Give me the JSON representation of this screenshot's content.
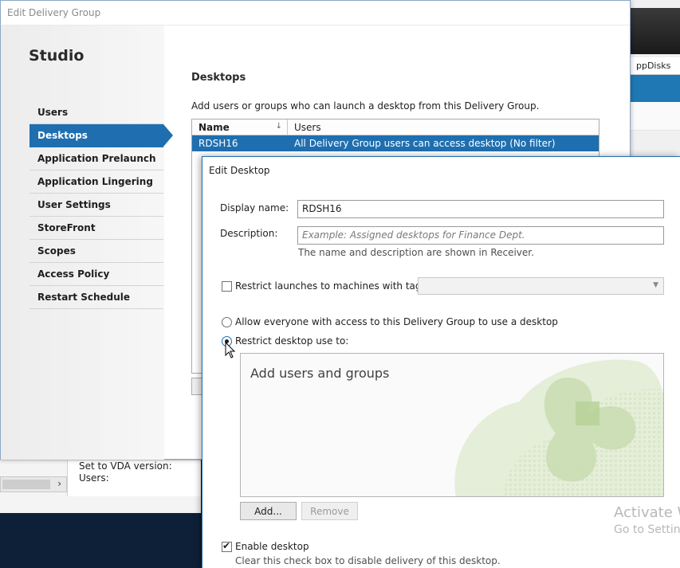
{
  "background_app": {
    "column_header": "ppDisks",
    "details": {
      "vda_version_label": "Set to VDA version:",
      "users_label": "Users:"
    },
    "scroll_arrow": "›"
  },
  "edit_delivery_group": {
    "window_title": "Edit Delivery Group",
    "brand": "Studio",
    "nav_items": [
      {
        "label": "Users",
        "active": false
      },
      {
        "label": "Desktops",
        "active": true
      },
      {
        "label": "Application Prelaunch",
        "active": false
      },
      {
        "label": "Application Lingering",
        "active": false
      },
      {
        "label": "User Settings",
        "active": false
      },
      {
        "label": "StoreFront",
        "active": false
      },
      {
        "label": "Scopes",
        "active": false
      },
      {
        "label": "Access Policy",
        "active": false
      },
      {
        "label": "Restart Schedule",
        "active": false
      }
    ],
    "heading": "Desktops",
    "description": "Add users or groups who can launch a desktop from this Delivery Group.",
    "table": {
      "columns": {
        "name": "Name",
        "users": "Users"
      },
      "sort_icon": "↓",
      "rows": [
        {
          "name": "RDSH16",
          "users": "All Delivery Group users can access desktop (No filter)"
        }
      ]
    }
  },
  "edit_desktop": {
    "title": "Edit Desktop",
    "display_name_label": "Display name:",
    "display_name_value": "RDSH16",
    "description_label": "Description:",
    "description_placeholder": "Example: Assigned desktops for Finance Dept.",
    "name_hint": "The name and description are shown in Receiver.",
    "restrict_tag_label": "Restrict launches to machines with tag:",
    "restrict_tag_checked": false,
    "allow_everyone_label": "Allow everyone with access to this Delivery Group to use a desktop",
    "restrict_use_label": "Restrict desktop use to:",
    "selected_option": "restrict",
    "users_area_title": "Add users and groups",
    "add_button": "Add...",
    "remove_button": "Remove",
    "enable_label": "Enable desktop",
    "enable_checked": true,
    "enable_hint": "Clear this check box to disable delivery of this desktop."
  },
  "watermark": {
    "line1": "Activate W",
    "line2": "Go to Settings"
  },
  "colors": {
    "accent": "#1f6fb0",
    "watermark": "#b8b8b8",
    "brand_art": "#b9d39b"
  }
}
